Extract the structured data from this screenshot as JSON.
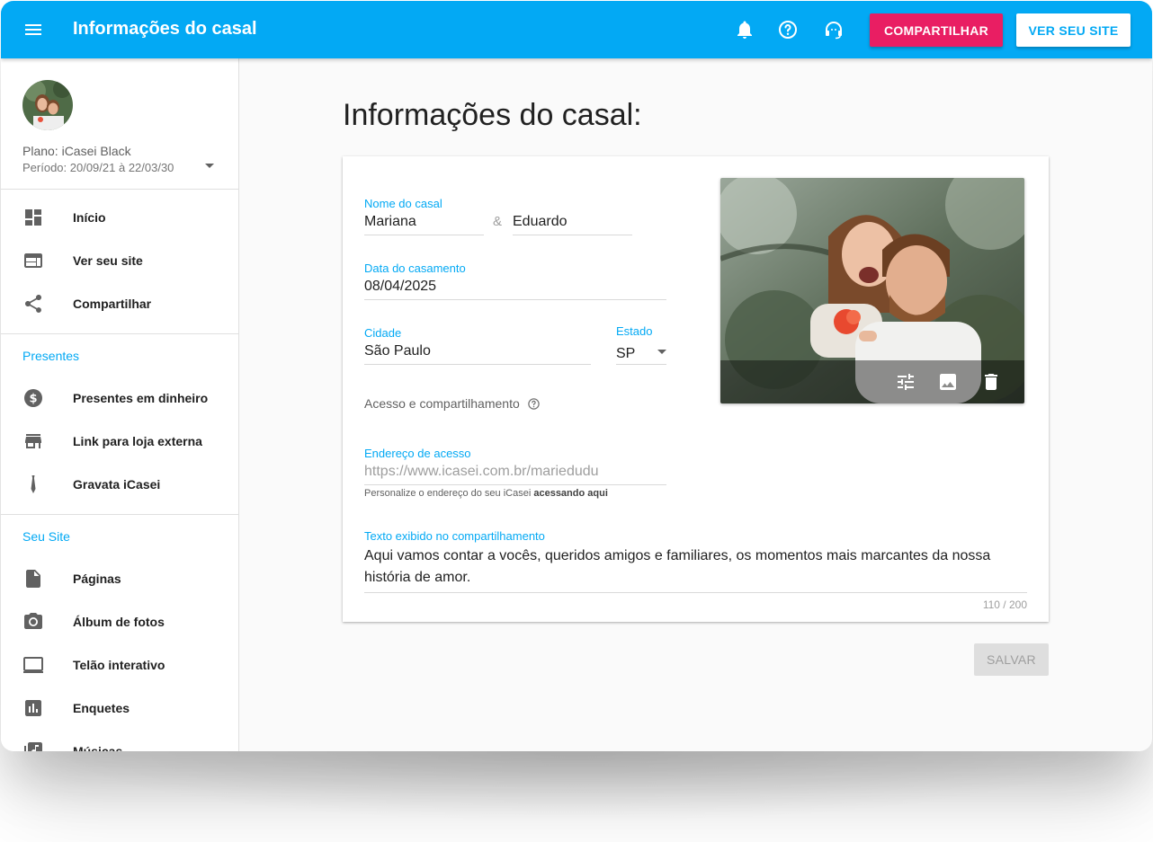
{
  "topbar": {
    "title": "Informações do casal",
    "share_label": "COMPARTILHAR",
    "site_label": "VER SEU SITE",
    "icons": [
      "menu-icon",
      "bell-icon",
      "help-icon",
      "support-icon"
    ]
  },
  "sidebar": {
    "plan": "Plano: iCasei Black",
    "period": "Período: 20/09/21 à 22/03/30",
    "main_items": [
      {
        "label": "Início",
        "icon": "dashboard-icon"
      },
      {
        "label": "Ver seu site",
        "icon": "web-icon"
      },
      {
        "label": "Compartilhar",
        "icon": "share-icon"
      }
    ],
    "presentes_title": "Presentes",
    "presentes_items": [
      {
        "label": "Presentes em dinheiro",
        "icon": "money-icon"
      },
      {
        "label": "Link para loja externa",
        "icon": "store-icon"
      },
      {
        "label": "Gravata iCasei",
        "icon": "tie-icon"
      }
    ],
    "site_title": "Seu Site",
    "site_items": [
      {
        "label": "Páginas",
        "icon": "page-icon"
      },
      {
        "label": "Álbum de fotos",
        "icon": "camera-icon"
      },
      {
        "label": "Telão interativo",
        "icon": "screen-icon"
      },
      {
        "label": "Enquetes",
        "icon": "poll-icon"
      },
      {
        "label": "Músicas",
        "icon": "music-icon"
      }
    ]
  },
  "main": {
    "title": "Informações do casal:",
    "form": {
      "couple_label": "Nome do casal",
      "name1": "Mariana",
      "amp": "&",
      "name2": "Eduardo",
      "date_label": "Data do casamento",
      "date": "08/04/2025",
      "city_label": "Cidade",
      "city": "São Paulo",
      "state_label": "Estado",
      "state": "SP",
      "access_title": "Acesso e compartilhamento",
      "address_label": "Endereço de acesso",
      "address_placeholder": "https://www.icasei.com.br/mariedudu",
      "hint_prefix": "Personalize o endereço do seu iCasei",
      "hint_link": "acessando aqui",
      "share_text_label": "Texto exibido no compartilhamento",
      "share_text_line1": "Aqui vamos contar a vocês, queridos amigos e familiares, os momentos mais marcantes da nossa",
      "share_text_line2": "história de amor.",
      "counter": "110 / 200"
    },
    "photo_actions": [
      "tune-icon",
      "image-icon",
      "delete-icon"
    ],
    "save_label": "SALVAR"
  }
}
